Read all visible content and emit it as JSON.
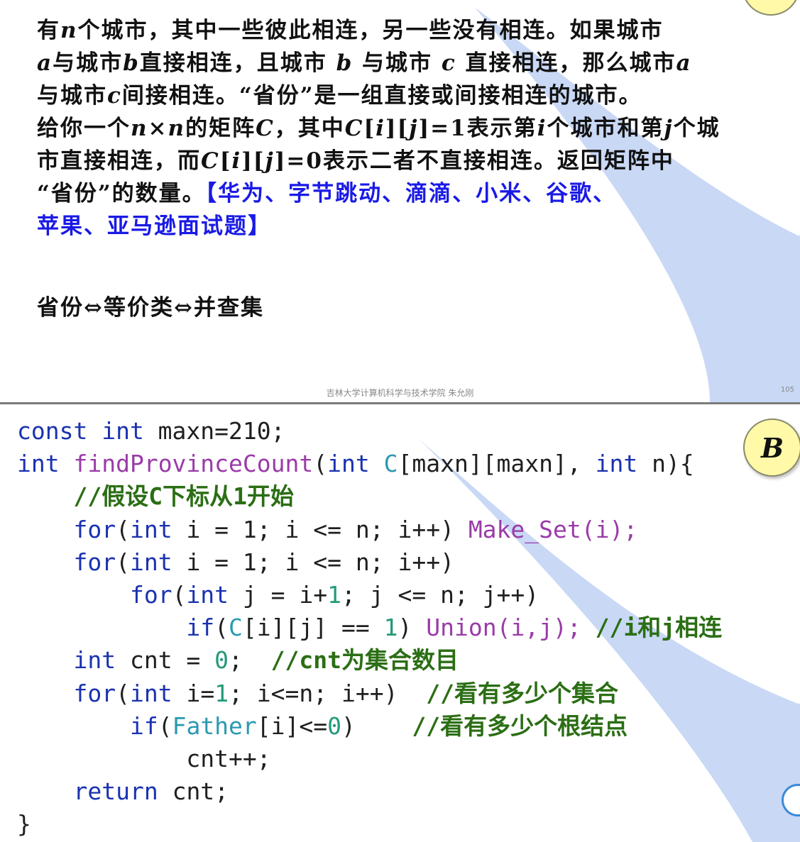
{
  "top_slide": {
    "problem_lines": [
      [
        {
          "t": "有"
        },
        {
          "t": "n",
          "v": true
        },
        {
          "t": "个城市，其中一些彼此相连，另一些没有相连。如果城市"
        }
      ],
      [
        {
          "t": "a",
          "v": true
        },
        {
          "t": "与城市"
        },
        {
          "t": "b",
          "v": true
        },
        {
          "t": "直接相连，且城市 "
        },
        {
          "t": "b",
          "v": true
        },
        {
          "t": " 与城市 "
        },
        {
          "t": "c",
          "v": true
        },
        {
          "t": " 直接相连，那么城市"
        },
        {
          "t": "a",
          "v": true
        }
      ],
      [
        {
          "t": "与城市"
        },
        {
          "t": "c",
          "v": true
        },
        {
          "t": "间接相连。“省份”是一组直接或间接相连的城市。"
        }
      ],
      [
        {
          "t": "给你一个"
        },
        {
          "t": "n",
          "v": true
        },
        {
          "t": "×"
        },
        {
          "t": "n",
          "v": true
        },
        {
          "t": "的矩阵"
        },
        {
          "t": "C",
          "v": true
        },
        {
          "t": "，其中"
        },
        {
          "t": "C",
          "v": true
        },
        {
          "t": "["
        },
        {
          "t": "i",
          "v": true
        },
        {
          "t": "]["
        },
        {
          "t": "j",
          "v": true
        },
        {
          "t": "]=1表示第"
        },
        {
          "t": "i",
          "v": true
        },
        {
          "t": "个城市和第"
        },
        {
          "t": "j",
          "v": true
        },
        {
          "t": "个城"
        }
      ],
      [
        {
          "t": "市直接相连，而"
        },
        {
          "t": "C",
          "v": true
        },
        {
          "t": "["
        },
        {
          "t": "i",
          "v": true
        },
        {
          "t": "]["
        },
        {
          "t": "j",
          "v": true
        },
        {
          "t": "]=0表示二者不直接相连。返回矩阵中"
        }
      ],
      [
        {
          "t": "“省份”的数量。"
        },
        {
          "t": "【华为、字节跳动、滴滴、小米、谷歌、",
          "h": true
        }
      ],
      [
        {
          "t": "苹果、亚马逊面试题】",
          "h": true
        }
      ]
    ],
    "equivalence_text": "省份⇔等价类⇔并查集",
    "footer_text": "吉林大学计算机科学与技术学院  朱允刚",
    "page_number": "105"
  },
  "bottom_slide": {
    "badge_label": "B",
    "code_lines": [
      [
        {
          "t": "const int",
          "c": "kw"
        },
        {
          "t": " maxn=210;"
        }
      ],
      [
        {
          "t": "int",
          "c": "kw"
        },
        {
          "t": " "
        },
        {
          "t": "findProvinceCount",
          "c": "fn"
        },
        {
          "t": "("
        },
        {
          "t": "int",
          "c": "kw"
        },
        {
          "t": " "
        },
        {
          "t": "C",
          "c": "ty"
        },
        {
          "t": "[maxn][maxn], "
        },
        {
          "t": "int",
          "c": "kw"
        },
        {
          "t": " n){"
        }
      ],
      [
        {
          "t": "    "
        },
        {
          "t": "//假设C下标从1开始",
          "c": "cm"
        }
      ],
      [
        {
          "t": "    "
        },
        {
          "t": "for",
          "c": "kw"
        },
        {
          "t": "("
        },
        {
          "t": "int",
          "c": "kw"
        },
        {
          "t": " i = 1; i <= n; i++) "
        },
        {
          "t": "Make_Set(i);",
          "c": "fn"
        }
      ],
      [
        {
          "t": "    "
        },
        {
          "t": "for",
          "c": "kw"
        },
        {
          "t": "("
        },
        {
          "t": "int",
          "c": "kw"
        },
        {
          "t": " i = 1; i <= n; i++)"
        }
      ],
      [
        {
          "t": "        "
        },
        {
          "t": "for",
          "c": "kw"
        },
        {
          "t": "("
        },
        {
          "t": "int",
          "c": "kw"
        },
        {
          "t": " j = i+"
        },
        {
          "t": "1",
          "c": "num"
        },
        {
          "t": "; j <= n; j++)"
        }
      ],
      [
        {
          "t": "            "
        },
        {
          "t": "if",
          "c": "kw"
        },
        {
          "t": "("
        },
        {
          "t": "C",
          "c": "ty"
        },
        {
          "t": "[i][j] == "
        },
        {
          "t": "1",
          "c": "num"
        },
        {
          "t": ") "
        },
        {
          "t": "Union(i,j);",
          "c": "fn"
        },
        {
          "t": " "
        },
        {
          "t": "//i和j相连",
          "c": "cm"
        }
      ],
      [
        {
          "t": "    "
        },
        {
          "t": "int",
          "c": "kw"
        },
        {
          "t": " cnt = "
        },
        {
          "t": "0",
          "c": "num"
        },
        {
          "t": ";  "
        },
        {
          "t": "//cnt为集合数目",
          "c": "cm"
        }
      ],
      [
        {
          "t": "    "
        },
        {
          "t": "for",
          "c": "kw"
        },
        {
          "t": "("
        },
        {
          "t": "int",
          "c": "kw"
        },
        {
          "t": " i="
        },
        {
          "t": "1",
          "c": "num"
        },
        {
          "t": "; i<=n; i++)  "
        },
        {
          "t": "//看有多少个集合",
          "c": "cm"
        }
      ],
      [
        {
          "t": "        "
        },
        {
          "t": "if",
          "c": "kw"
        },
        {
          "t": "("
        },
        {
          "t": "Father",
          "c": "ty"
        },
        {
          "t": "[i]<="
        },
        {
          "t": "0",
          "c": "num"
        },
        {
          "t": ")    "
        },
        {
          "t": "//看有多少个根结点",
          "c": "cm"
        }
      ],
      [
        {
          "t": "            cnt++;"
        }
      ],
      [
        {
          "t": "    "
        },
        {
          "t": "return",
          "c": "kw"
        },
        {
          "t": " cnt;"
        }
      ],
      [
        {
          "t": "}"
        }
      ]
    ]
  },
  "colors": {
    "keyword": "#1a32b0",
    "function": "#9a3ba8",
    "comment": "#2b6e14",
    "number": "#239a7a",
    "type": "#2a9ab0",
    "highlight_text": "#1a1ae6",
    "decor_blue": "#c9d8f5",
    "badge_fill": "#fff9a8"
  }
}
